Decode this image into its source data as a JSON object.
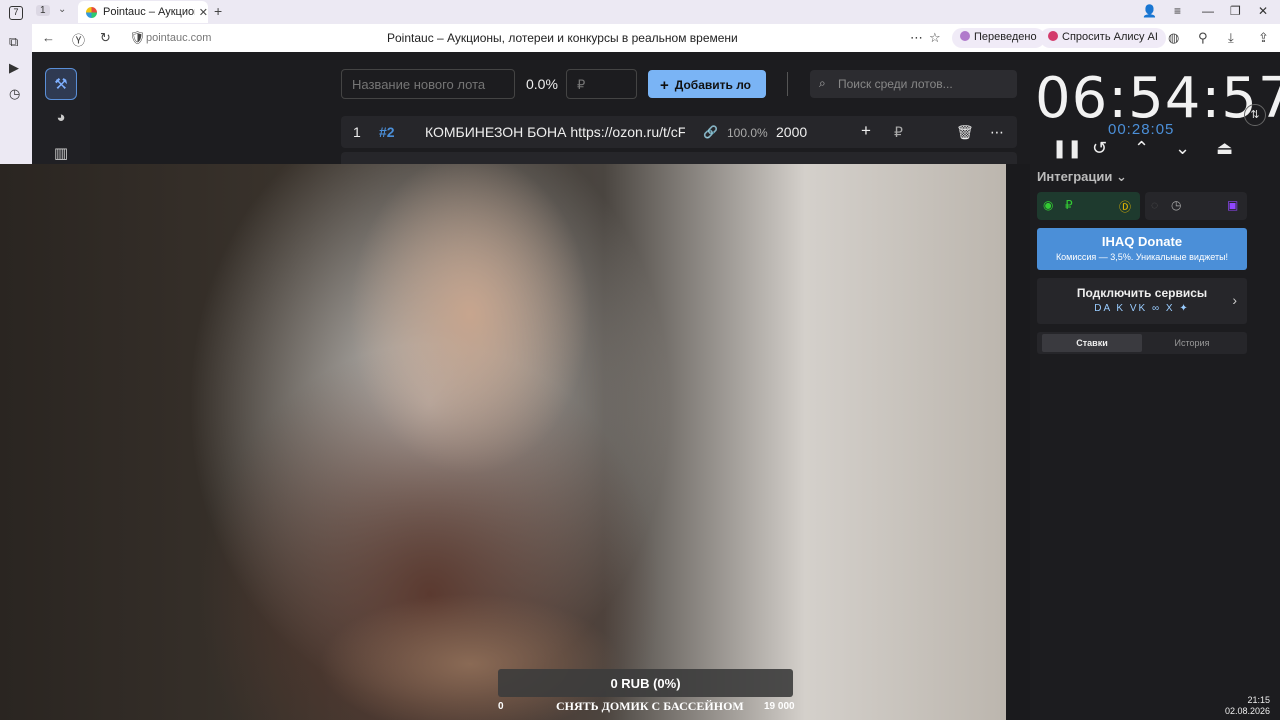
{
  "browser": {
    "tab_counter": "7",
    "tab_num": "1",
    "tab_title": "Pointauc – Аукционы,",
    "url": "pointauc.com",
    "page_title": "Pointauc – Аукционы, лотереи и конкурсы в реальном времени",
    "translated_label": "Переведено",
    "ask_alice_label": "Спросить Алису AI"
  },
  "toolbar": {
    "lot_name_placeholder": "Название нового лота",
    "percent": "0.0%",
    "rub_placeholder": "₽",
    "add_label": "Добавить ло",
    "search_placeholder": "Поиск среди лотов..."
  },
  "lots": [
    {
      "index": "1",
      "hash": "#2",
      "name": "КОМБИНЕЗОН БОНА https://ozon.ru/t/cF",
      "percent": "100.0%",
      "amount": "2000",
      "currency": "₽"
    }
  ],
  "timer": {
    "main": "06:54:57",
    "secondary": "00:28:05",
    "integrations_label": "Интеграции"
  },
  "donate": {
    "title": "IHAQ Donate",
    "subtitle": "Комиссия — 3,5%. Уникальные виджеты!"
  },
  "services": {
    "title": "Подключить сервисы",
    "icons": "DA K VK ∞ X ✦"
  },
  "history_tabs": [
    "Ставки",
    "История"
  ],
  "video": {
    "goal_progress": "0 RUB (0%)",
    "goal_fraction": 0,
    "goal_min": "0",
    "goal_max": "19 000",
    "goal_caption": "СНЯТЬ ДОМИК С БАССЕЙНОМ"
  },
  "clock": {
    "time": "21:15",
    "date": "02.08.2026"
  },
  "colors": {
    "accent": "#4b8fd8",
    "add_button": "#7ab4f5",
    "background": "#1c1c1f"
  }
}
